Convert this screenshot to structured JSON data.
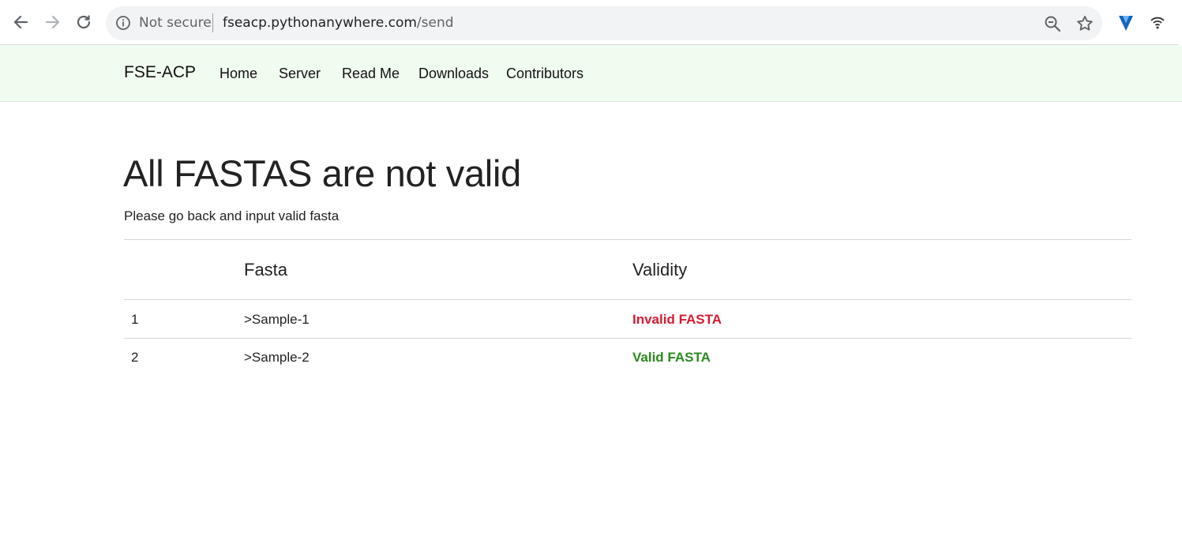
{
  "browser": {
    "security_label": "Not secure",
    "url_host": "fseacp.pythonanywhere.com",
    "url_path": "/send",
    "icons": [
      "back-arrow-icon",
      "forward-arrow-icon",
      "reload-icon",
      "info-icon",
      "zoom-icon",
      "star-icon",
      "extension-v-icon",
      "extension-wifi-icon"
    ]
  },
  "navbar": {
    "brand": "FSE-ACP",
    "links": [
      {
        "label": "Home"
      },
      {
        "label": "Server"
      },
      {
        "label": "Read Me"
      },
      {
        "label": "Downloads"
      },
      {
        "label": "Contributors"
      }
    ]
  },
  "main": {
    "title": "All FASTAS are not valid",
    "subtitle": "Please go back and input valid fasta"
  },
  "table": {
    "headers": [
      "",
      "Fasta",
      "Validity"
    ],
    "rows": [
      {
        "index": "1",
        "fasta": ">Sample-1",
        "validity": "Invalid FASTA",
        "status": "invalid"
      },
      {
        "index": "2",
        "fasta": ">Sample-2",
        "validity": "Valid FASTA",
        "status": "valid"
      }
    ]
  },
  "colors": {
    "navbar_bg": "#f1fcf0",
    "invalid": "#d81b2f",
    "valid": "#2a8a1e"
  }
}
